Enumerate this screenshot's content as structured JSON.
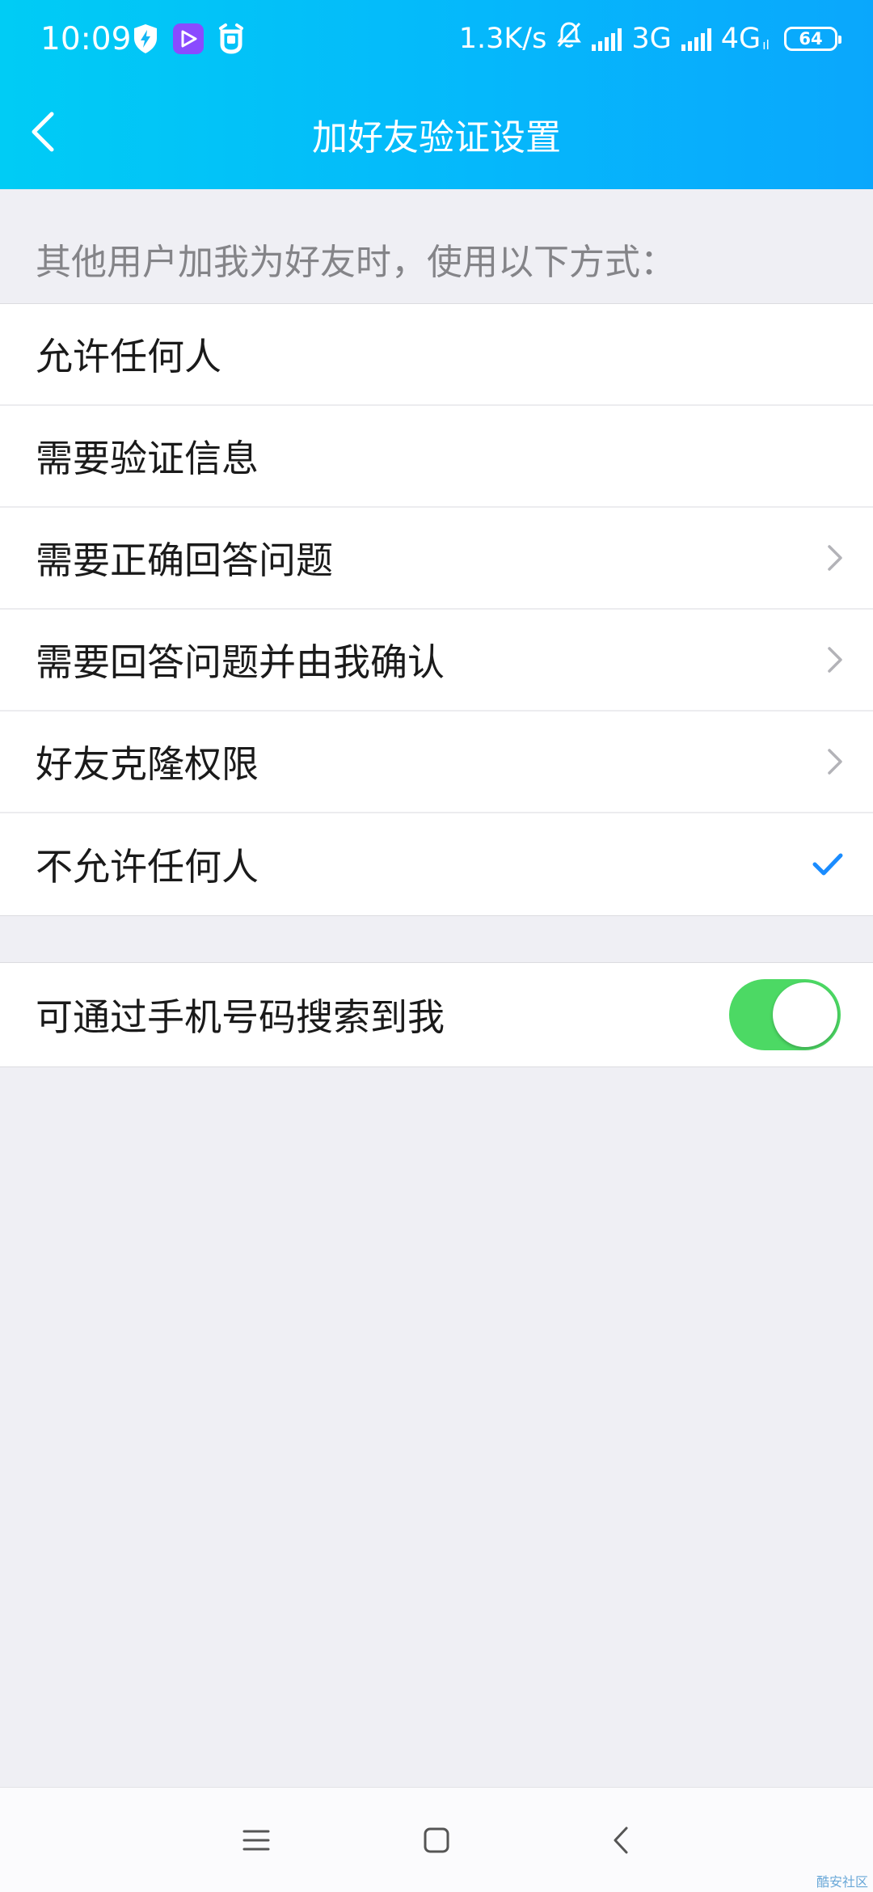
{
  "status_bar": {
    "time": "10:09",
    "net_speed": "1.3K/s",
    "sim1_type": "3G",
    "sim2_type": "4G",
    "sim2_sub": "ıl",
    "battery": "64",
    "icons": [
      "shield-bolt-icon",
      "video-app-icon",
      "alarm-app-icon",
      "bell-muted-icon",
      "signal-icon",
      "signal-icon",
      "battery-icon"
    ]
  },
  "header": {
    "title": "加好友验证设置",
    "back_icon": "chevron-left-icon"
  },
  "section": {
    "hint": "其他用户加我为好友时，使用以下方式："
  },
  "options": [
    {
      "label": "允许任何人",
      "trail": "none"
    },
    {
      "label": "需要验证信息",
      "trail": "none"
    },
    {
      "label": "需要正确回答问题",
      "trail": "chevron"
    },
    {
      "label": "需要回答问题并由我确认",
      "trail": "chevron"
    },
    {
      "label": "好友克隆权限",
      "trail": "chevron"
    },
    {
      "label": "不允许任何人",
      "trail": "check"
    }
  ],
  "phone_search": {
    "label": "可通过手机号码搜索到我",
    "enabled": true
  },
  "bottom_nav": {
    "icons": [
      "menu-icon",
      "home-square-icon",
      "back-chevron-icon"
    ]
  },
  "watermark": "酷安社区",
  "colors": {
    "header_start": "#00ccf5",
    "header_end": "#0aa7fc",
    "check": "#1a8cff",
    "toggle_on": "#4cd964",
    "chevron": "#b3b3b8"
  }
}
